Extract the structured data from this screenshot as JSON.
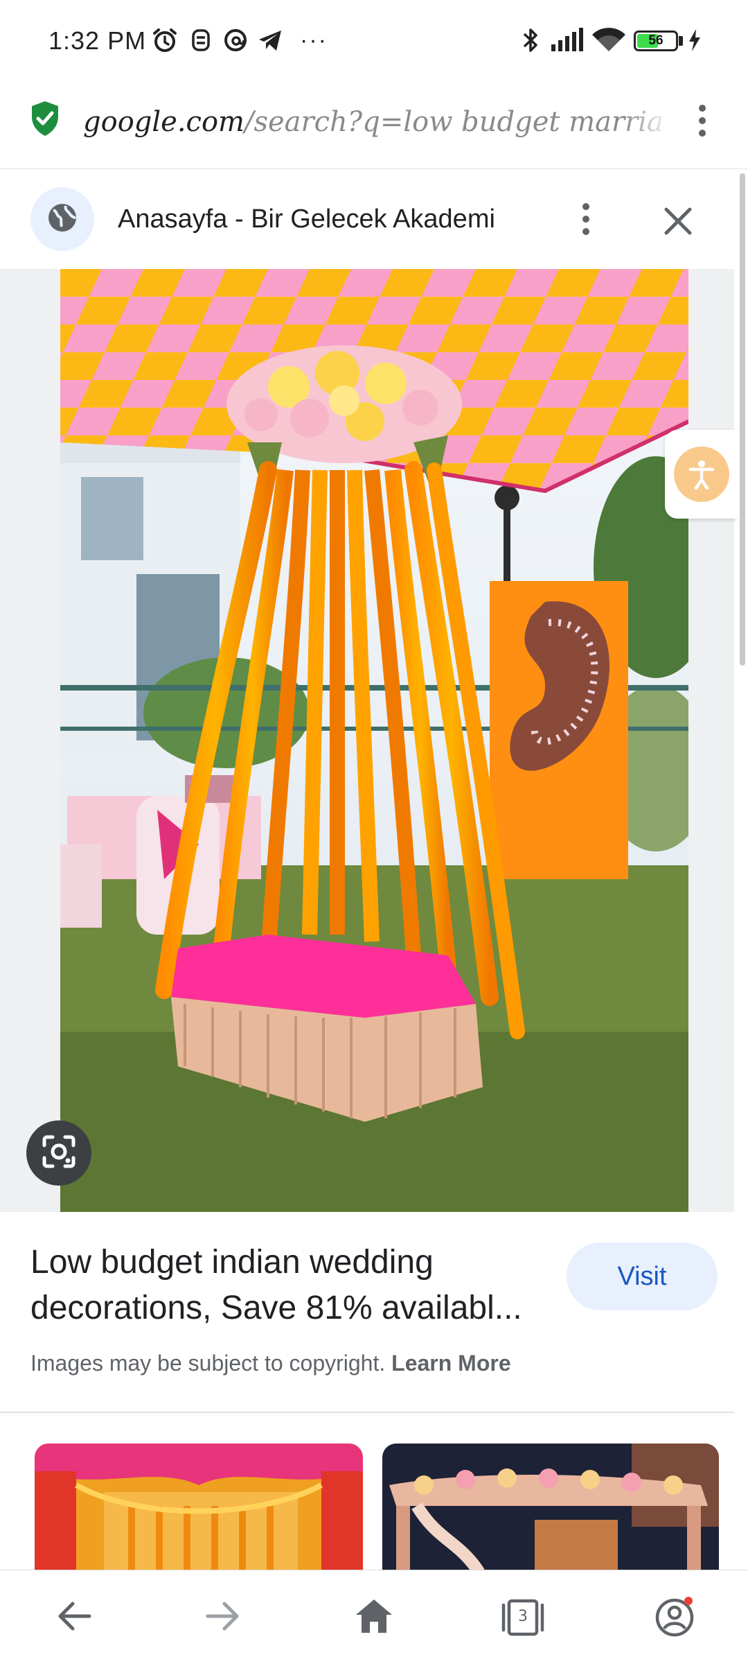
{
  "status_bar": {
    "time": "1:32 PM",
    "battery_level": "56",
    "battery_fraction": 0.56,
    "icons": [
      "alarm-icon",
      "app-icon",
      "threads-icon",
      "telegram-icon",
      "more-notifications-icon",
      "bluetooth-icon",
      "signal-icon",
      "wifi-icon",
      "battery-icon",
      "charging-icon"
    ],
    "more_label": "···"
  },
  "url_bar": {
    "domain": "google.com",
    "path": "/search?q=low budget marriage mo",
    "secure_icon": "shield-check-icon",
    "menu_icon": "more-vert-icon"
  },
  "panel": {
    "site_icon": "globe-icon",
    "title": "Anasayfa - Bir Gelecek Akademi",
    "menu_icon": "more-vert-icon",
    "close_icon": "close-icon"
  },
  "image": {
    "lens_icon": "google-lens-icon",
    "accessibility_icon": "accessibility-icon"
  },
  "result": {
    "title": "Low budget indian wedding decorations, Save 81% availabl...",
    "visit_label": "Visit",
    "copyright_text": "Images may be subject to copyright.",
    "learn_more_label": "Learn More"
  },
  "related": {
    "count": 2
  },
  "bottom_nav": {
    "tab_count": "3",
    "icons": [
      "back-arrow-icon",
      "forward-arrow-icon",
      "home-icon",
      "tabs-icon",
      "account-icon"
    ]
  },
  "colors": {
    "accent_blue": "#1a57c0",
    "visit_bg": "#e8f0fe",
    "secure_green": "#1e8e3e",
    "battery_green": "#3ddc4a",
    "notification_dot": "#ea4335"
  }
}
